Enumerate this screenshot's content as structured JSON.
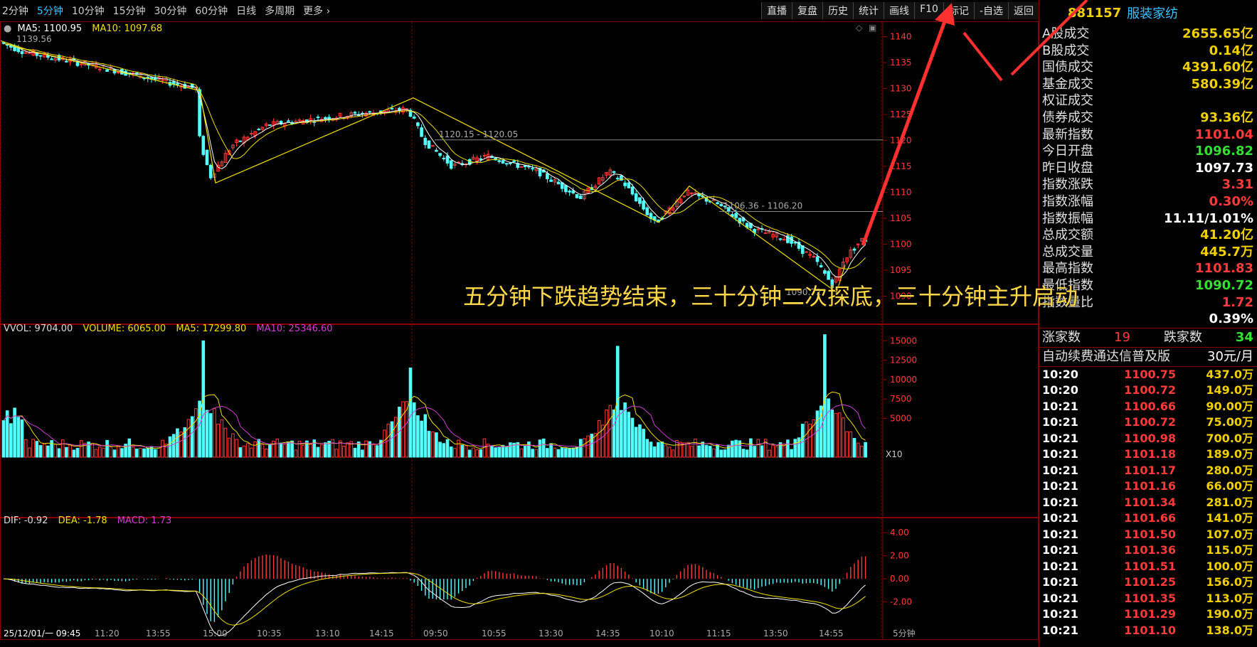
{
  "toolbar": {
    "periods": [
      "2分钟",
      "5分钟",
      "10分钟",
      "15分钟",
      "30分钟",
      "60分钟",
      "日线",
      "多周期",
      "更多"
    ],
    "active_period": "5分钟",
    "buttons": [
      "直播",
      "复盘",
      "历史",
      "统计",
      "画线",
      "F10",
      "标记",
      "-自选",
      "返回"
    ]
  },
  "price_legend": {
    "ma5": "MA5: 1100.95",
    "ma10": "MA10: 1097.68"
  },
  "price_axis": [
    "1140",
    "1135",
    "1130",
    "1125",
    "1120",
    "1115",
    "1110",
    "1105",
    "1100",
    "1095",
    "1090"
  ],
  "price_annotations": {
    "high_label": "1139.56",
    "low_label": "1090.72",
    "line1": "1120.15 - 1120.05",
    "line2": "1106.36 - 1106.20"
  },
  "vol_legend": {
    "vvol": "VVOL: 9704.00",
    "volume": "VOLUME: 6065.00",
    "ma5": "MA5: 17299.80",
    "ma10": "MA10: 25346.60"
  },
  "vol_axis": [
    "15000",
    "12500",
    "10000",
    "7500",
    "5000"
  ],
  "vol_multiplier": "X10",
  "macd_legend": {
    "dif": "DIF: -0.92",
    "dea": "DEA: -1.78",
    "macd": "MACD: 1.73"
  },
  "macd_axis": [
    "4.00",
    "2.00",
    "0.00",
    "-2.00"
  ],
  "time_axis": [
    "25/12/01/一 09:45",
    "11:20",
    "13:55",
    "15:00",
    "10:35",
    "13:10",
    "14:15",
    "09:50",
    "10:55",
    "13:30",
    "14:35",
    "10:10",
    "11:15",
    "13:50",
    "14:55",
    "5分钟"
  ],
  "annotation_text": "五分钟下跌趋势结束，三十分钟二次探底，三十分钟主升启动",
  "sector": {
    "code": "881157",
    "name": "服装家纺"
  },
  "stats": [
    {
      "label": "A股成交",
      "value": "2655.65亿",
      "color": "ylw"
    },
    {
      "label": "B股成交",
      "value": "0.14亿",
      "color": "ylw"
    },
    {
      "label": "国债成交",
      "value": "4391.60亿",
      "color": "ylw"
    },
    {
      "label": "基金成交",
      "value": "580.39亿",
      "color": "ylw"
    },
    {
      "label": "权证成交",
      "value": "",
      "color": "ylw"
    },
    {
      "label": "债券成交",
      "value": "93.36亿",
      "color": "ylw"
    },
    {
      "label": "最新指数",
      "value": "1101.04",
      "color": "red"
    },
    {
      "label": "今日开盘",
      "value": "1096.82",
      "color": "grn"
    },
    {
      "label": "昨日收盘",
      "value": "1097.73",
      "color": "wht"
    },
    {
      "label": "指数涨跌",
      "value": "3.31",
      "color": "red"
    },
    {
      "label": "指数涨幅",
      "value": "0.30%",
      "color": "red"
    },
    {
      "label": "指数振幅",
      "value": "11.11/1.01%",
      "color": "wht"
    },
    {
      "label": "总成交额",
      "value": "41.20亿",
      "color": "ylw"
    },
    {
      "label": "总成交量",
      "value": "445.7万",
      "color": "ylw"
    },
    {
      "label": "最高指数",
      "value": "1101.83",
      "color": "red"
    },
    {
      "label": "最低指数",
      "value": "1090.72",
      "color": "grn"
    },
    {
      "label": "指数量比",
      "value": "1.72",
      "color": "red"
    },
    {
      "label": "",
      "value": "0.39%",
      "color": "wht"
    }
  ],
  "breadth": {
    "up_label": "涨家数",
    "up_value": "19",
    "down_label": "跌家数",
    "down_value": "34"
  },
  "subscription": {
    "label": "自动续费通达信普及版",
    "price": "30元/月"
  },
  "ticks": [
    {
      "t": "10:20",
      "p": "1100.75",
      "v": "437.0万"
    },
    {
      "t": "10:20",
      "p": "1100.72",
      "v": "149.0万"
    },
    {
      "t": "10:21",
      "p": "1100.66",
      "v": "90.00万"
    },
    {
      "t": "10:21",
      "p": "1100.72",
      "v": "75.00万"
    },
    {
      "t": "10:21",
      "p": "1100.98",
      "v": "700.0万"
    },
    {
      "t": "10:21",
      "p": "1101.18",
      "v": "189.0万"
    },
    {
      "t": "10:21",
      "p": "1101.17",
      "v": "280.0万"
    },
    {
      "t": "10:21",
      "p": "1101.16",
      "v": "66.00万"
    },
    {
      "t": "10:21",
      "p": "1101.34",
      "v": "281.0万"
    },
    {
      "t": "10:21",
      "p": "1101.66",
      "v": "141.0万"
    },
    {
      "t": "10:21",
      "p": "1101.50",
      "v": "107.0万"
    },
    {
      "t": "10:21",
      "p": "1101.36",
      "v": "115.0万"
    },
    {
      "t": "10:21",
      "p": "1101.51",
      "v": "100.0万"
    },
    {
      "t": "10:21",
      "p": "1101.25",
      "v": "156.0万"
    },
    {
      "t": "10:21",
      "p": "1101.35",
      "v": "113.0万"
    },
    {
      "t": "10:21",
      "p": "1101.29",
      "v": "190.0万"
    },
    {
      "t": "10:21",
      "p": "1101.10",
      "v": "138.0万"
    }
  ],
  "colors": {
    "up": "#ff3a3a",
    "down": "#54ffff",
    "ma5": "#ffffff",
    "ma10": "#f0e000",
    "zigzag": "#f0e000",
    "macd_line": "#d040d0",
    "grid": "#8a0000"
  },
  "zigzag_points": [
    [
      0,
      1139.2
    ],
    [
      44,
      1137.2
    ],
    [
      280,
      1129.6
    ],
    [
      302,
      1111.8
    ],
    [
      580,
      1128.2
    ],
    [
      925,
      1104.2
    ],
    [
      968,
      1111.2
    ],
    [
      1175,
      1090.72
    ],
    [
      1187,
      1096
    ]
  ]
}
